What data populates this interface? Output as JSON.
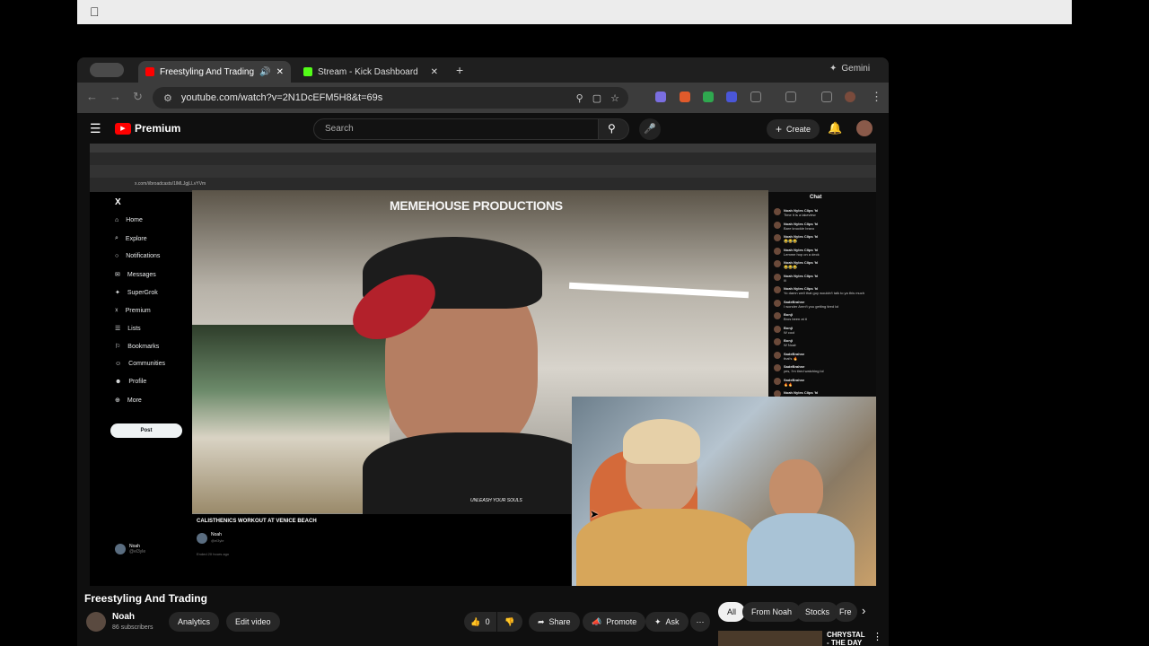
{
  "tabs": [
    {
      "label": "Freestyling And Trading"
    },
    {
      "label": "Stream - Kick Dashboard"
    }
  ],
  "gemini_label": "Gemini",
  "url": "youtube.com/watch?v=2N1DcEFM5H8&t=69s",
  "yt": {
    "logo_text": "Premium",
    "search_placeholder": "Search",
    "create_label": "Create"
  },
  "inner": {
    "url": "x.com/i/broadcasts/1lMLJgjLLvYVm",
    "watermark": "MEMEHOUSE PRODUCTIONS",
    "broadcast_title": "CALISTHENICS WORKOUT AT VENICE BEACH",
    "broadcast_user": "Noah",
    "broadcast_handle": "@el3yle",
    "broadcast_meta": "Ended 20 hours ago",
    "shirt_text": "UNLEASH YOUR SOULS",
    "chat_title": "Chat",
    "nav": [
      "Home",
      "Explore",
      "Notifications",
      "Messages",
      "SuperGrok",
      "Premium",
      "Lists",
      "Bookmarks",
      "Communities",
      "Profile",
      "More"
    ],
    "post_label": "Post",
    "side_user": "Noah",
    "side_handle": "@el3yle",
    "chat": [
      {
        "name": "Noah Nyles Clips 'hl",
        "msg": "Time it is a lakeview"
      },
      {
        "name": "Noah Nyles Clips 'hl",
        "msg": "Bare knuckle bravo"
      },
      {
        "name": "Noah Nyles Clips 'hl",
        "msg": "😂😂😂"
      },
      {
        "name": "Noah Nyles Clips 'hl",
        "msg": "Lemme hop on a deck"
      },
      {
        "name": "Noah Nyles Clips 'hl",
        "msg": "😂😂😂"
      },
      {
        "name": "Noah Nyles Clips 'hl",
        "msg": "lil"
      },
      {
        "name": "Noah Nyles Clips 'hl",
        "msg": "Yo damn well that guy wouldn't talk to ya this much"
      },
      {
        "name": "SadeBrahne",
        "msg": "I wonder Aren't you getting tired lol"
      },
      {
        "name": "Bonji",
        "msg": "Bros been at it"
      },
      {
        "name": "Bonji",
        "msg": "W cool"
      },
      {
        "name": "Bonji",
        "msg": "W Noah"
      },
      {
        "name": "SadeBrahne",
        "msg": "that's 🔥"
      },
      {
        "name": "SadeBrahne",
        "msg": "yes, I'm tired watching lol"
      },
      {
        "name": "SadeBrahne",
        "msg": "🔥🔥"
      },
      {
        "name": "Noah Nyles Clips 'hl",
        "msg": ""
      }
    ]
  },
  "video_title": "Freestyling And Trading",
  "channel": {
    "name": "Noah",
    "subs": "86 subscribers"
  },
  "actions": {
    "analytics": "Analytics",
    "edit_video": "Edit video",
    "likes": "0",
    "share": "Share",
    "promote": "Promote",
    "ask": "Ask"
  },
  "chips": [
    "All",
    "From Noah",
    "Stocks",
    "Fre"
  ],
  "sidebar_video": {
    "title_line1": "CHRYSTAL",
    "title_line2": "- THE DAY"
  },
  "colors": {
    "yt_red": "#ff0000",
    "kick_green": "#53fc18",
    "bg": "#0f0f0f"
  }
}
